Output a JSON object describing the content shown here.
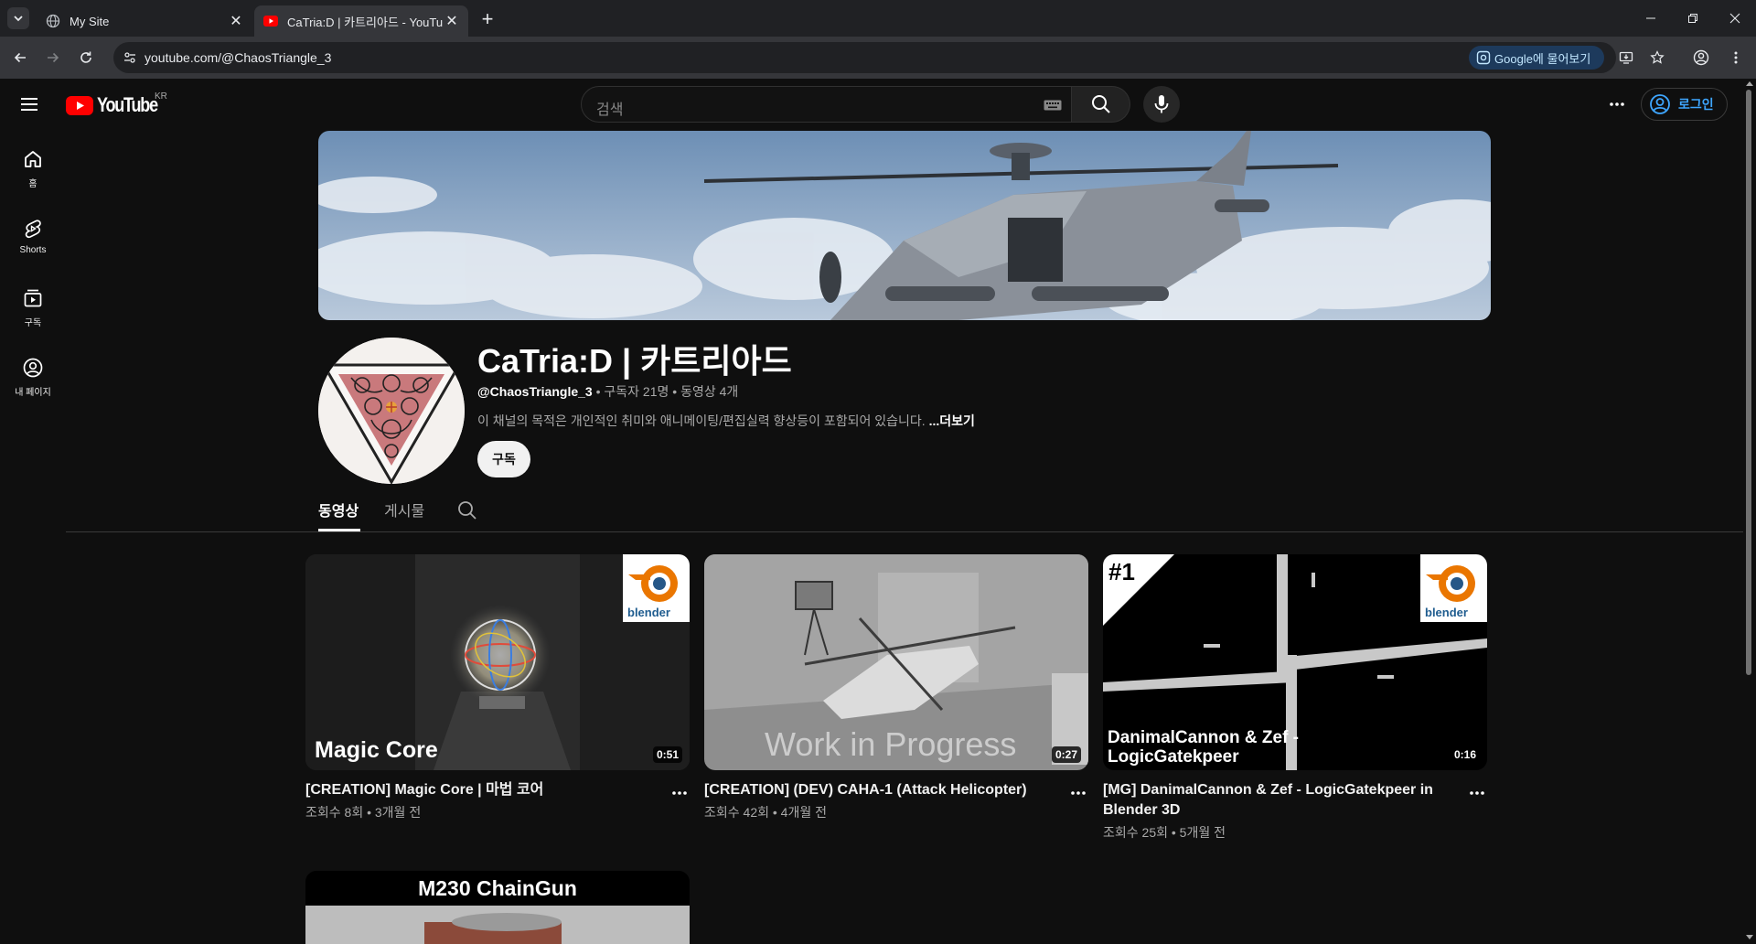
{
  "browser": {
    "tabs": [
      {
        "title": "My Site",
        "active": false
      },
      {
        "title": "CaTria:D | 카트리아드 - YouTube",
        "active": true
      }
    ],
    "url": "youtube.com/@ChaosTriangle_3",
    "lens_chip": "Google에 물어보기"
  },
  "masthead": {
    "logo_text": "YouTube",
    "country": "KR",
    "search_placeholder": "검색",
    "signin_label": "로그인"
  },
  "guide": {
    "items": [
      {
        "label": "홈",
        "icon": "home-icon"
      },
      {
        "label": "Shorts",
        "icon": "shorts-icon"
      },
      {
        "label": "구독",
        "icon": "subscriptions-icon"
      },
      {
        "label": "내 페이지",
        "icon": "profile-icon"
      }
    ]
  },
  "channel": {
    "title": "CaTria:D | 카트리아드",
    "handle": "@ChaosTriangle_3",
    "subscribers": "구독자 21명",
    "video_count": "동영상 4개",
    "separator": "•",
    "description": "이 채널의 목적은 개인적인 취미와 애니메이팅/편집실력 향상등이 포함되어 있습니다.",
    "more_label": "...더보기",
    "subscribe_label": "구독"
  },
  "channel_tabs": [
    {
      "label": "동영상",
      "active": true
    },
    {
      "label": "게시물",
      "active": false
    }
  ],
  "videos": [
    {
      "title": "[CREATION] Magic Core | 마법 코어",
      "views": "조회수 8회",
      "age": "3개월 전",
      "duration": "0:51",
      "thumb_caption": "Magic Core",
      "badge": "blender"
    },
    {
      "title": "[CREATION] (DEV) CAHA-1 (Attack Helicopter)",
      "views": "조회수 42회",
      "age": "4개월 전",
      "duration": "0:27",
      "thumb_caption": "Work in Progress"
    },
    {
      "title": "[MG] DanimalCannon & Zef - LogicGatekpeer in Blender 3D",
      "views": "조회수 25회",
      "age": "5개월 전",
      "duration": "0:16",
      "thumb_caption_line1": "DanimalCannon & Zef -",
      "thumb_caption_line2": "LogicGatekpeer",
      "rank": "#1",
      "badge": "blender"
    },
    {
      "thumb_caption": "M230 ChainGun"
    }
  ],
  "colors": {
    "background": "#0f0f0f",
    "youtube_red": "#ff0000",
    "link_blue": "#3ea6ff",
    "secondary_text": "#aaaaaa"
  }
}
